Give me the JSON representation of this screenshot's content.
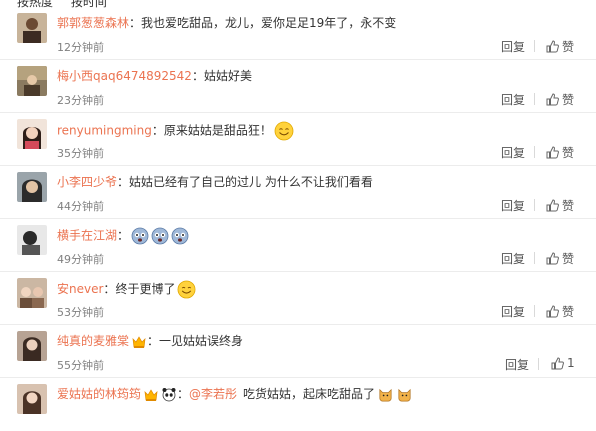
{
  "tabs": [
    "按热度",
    "按时间"
  ],
  "colors": {
    "username": "#eb7350",
    "text": "#333333",
    "meta": "#808080"
  },
  "comments": [
    {
      "user": "郭郭葱葱森林",
      "text": "我也爱吃甜品，龙儿，爱你足足19年了，永不变",
      "time": "12分钟前",
      "reply": "回复",
      "like": "赞"
    },
    {
      "user": "梅小西qaq6474892542",
      "text": "姑姑好美",
      "time": "23分钟前",
      "reply": "回复",
      "like": "赞"
    },
    {
      "user": "renyumingming",
      "text": "原来姑姑是甜品狂！",
      "time": "35分钟前",
      "reply": "回复",
      "like": "赞",
      "emoji": "smile-emoji"
    },
    {
      "user": "小李四少爷",
      "text": "姑姑已经有了自己的过儿 为什么不让我们看看",
      "time": "44分钟前",
      "reply": "回复",
      "like": "赞"
    },
    {
      "user": "横手在江湖",
      "text": "",
      "time": "49分钟前",
      "reply": "回复",
      "like": "赞",
      "emoji": "crying-emoji"
    },
    {
      "user": "安never",
      "text": "终于更博了",
      "time": "53分钟前",
      "reply": "回复",
      "like": "赞",
      "emoji": "smile-emoji"
    },
    {
      "user": "纯真的麦雅棠",
      "text": "一见姑姑误终身",
      "time": "55分钟前",
      "reply": "回复",
      "like": "1",
      "badge": "vip-badge"
    },
    {
      "user": "爱姑姑的林筠筠",
      "mention": "@李若彤",
      "text": "吃货姑姑，起床吃甜品了",
      "time": "",
      "reply": "",
      "like": "",
      "badge": "vip-badge",
      "emoji": "cat-emoji"
    }
  ]
}
